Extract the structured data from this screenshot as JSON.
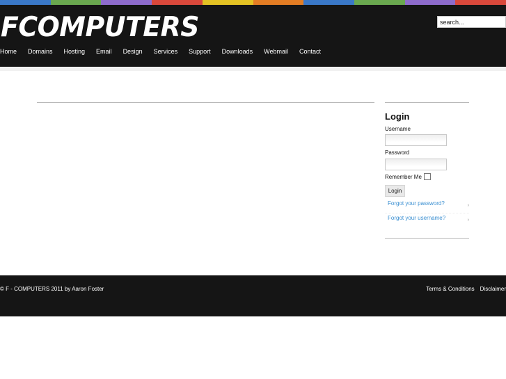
{
  "brand": {
    "logo_text": "FCOMPUTERS"
  },
  "colorbar": [
    "#3a78c8",
    "#6aa84f",
    "#8e6ccc",
    "#d9483b",
    "#e3c224",
    "#e37d24",
    "#3a78c8",
    "#6aa84f",
    "#8e6ccc",
    "#d9483b"
  ],
  "search": {
    "placeholder": "search..."
  },
  "nav": {
    "items": [
      {
        "label": "Home"
      },
      {
        "label": "Domains"
      },
      {
        "label": "Hosting"
      },
      {
        "label": "Email"
      },
      {
        "label": "Design"
      },
      {
        "label": "Services"
      },
      {
        "label": "Support"
      },
      {
        "label": "Downloads"
      },
      {
        "label": "Webmail"
      },
      {
        "label": "Contact"
      }
    ]
  },
  "login": {
    "title": "Login",
    "username_label": "Username",
    "username_value": "",
    "password_label": "Password",
    "password_value": "",
    "remember_label": "Remember Me",
    "remember_checked": false,
    "button_label": "Login",
    "forgot_password": "Forgot your password?",
    "forgot_username": "Forgot your username?",
    "link_arrow": "›"
  },
  "footer": {
    "copyright": "© F - COMPUTERS 2011 by Aaron Foster",
    "links": [
      {
        "label": "Terms & Conditions"
      },
      {
        "label": "Disclaimer"
      }
    ]
  }
}
